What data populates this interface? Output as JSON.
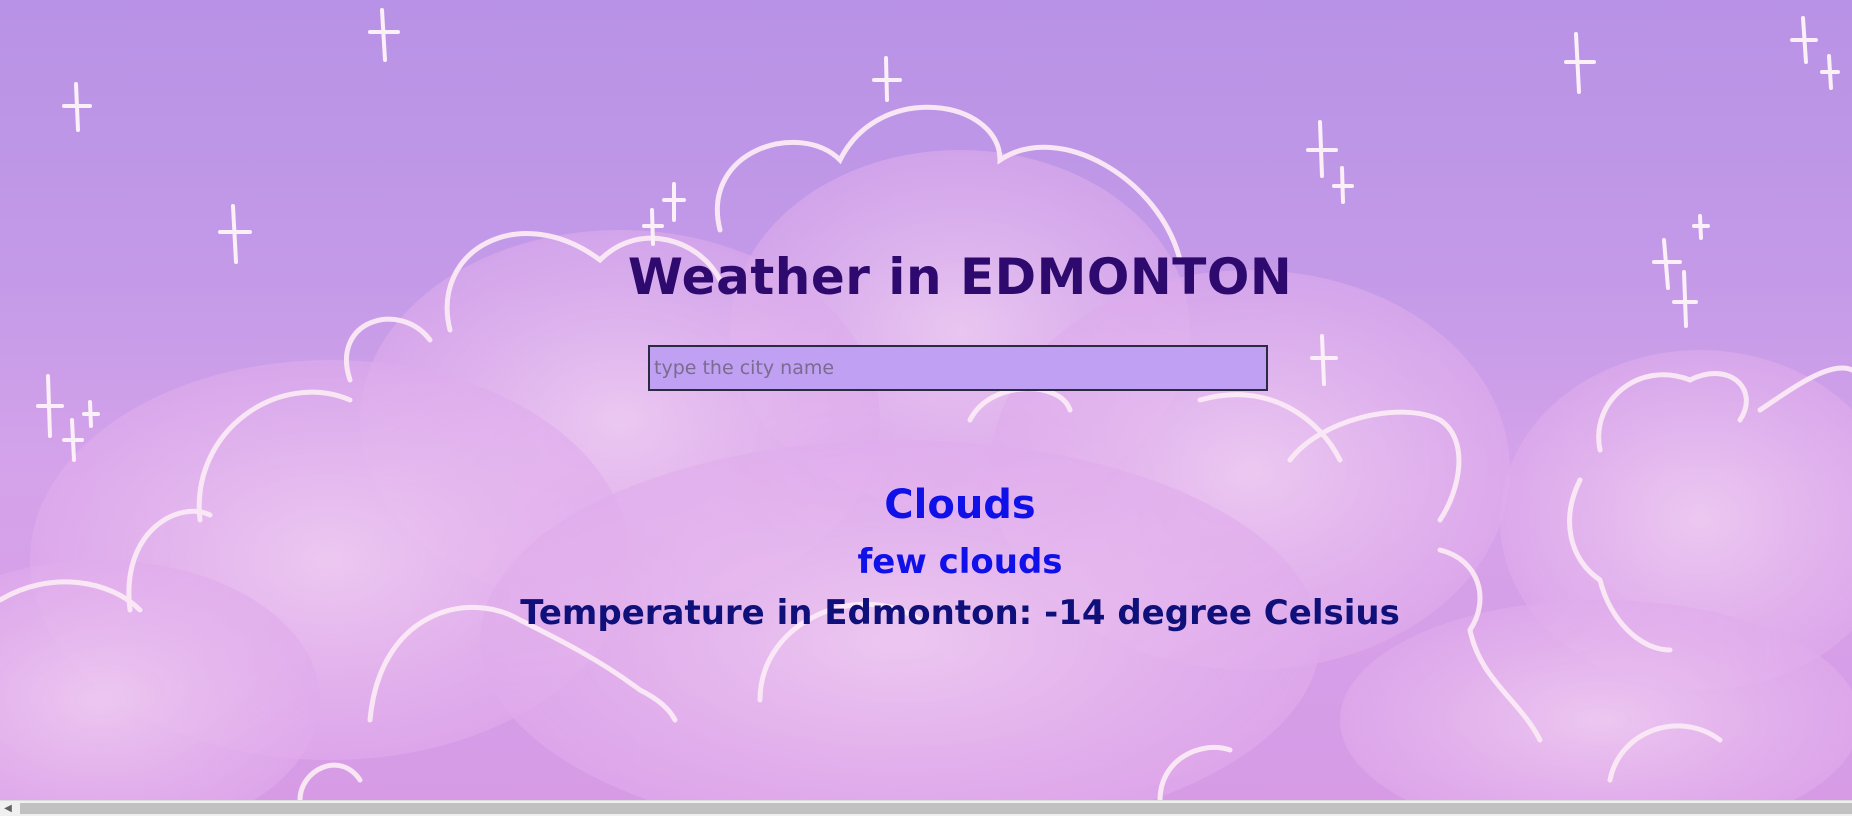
{
  "header": {
    "title": "Weather in EDMONTON"
  },
  "search": {
    "placeholder": "type the city name",
    "value": ""
  },
  "weather": {
    "main": "Clouds",
    "description": "few clouds",
    "temperature_text": "Temperature in Edmonton: -14 degree Celsius"
  },
  "colors": {
    "background": "#c49ae8",
    "title": "#2e0a6e",
    "main": "#1010e8",
    "temperature": "#10107a",
    "input_background": "#c0a0f2"
  },
  "scrollbar": {
    "left_arrow_icon": "chevron-left-icon"
  }
}
